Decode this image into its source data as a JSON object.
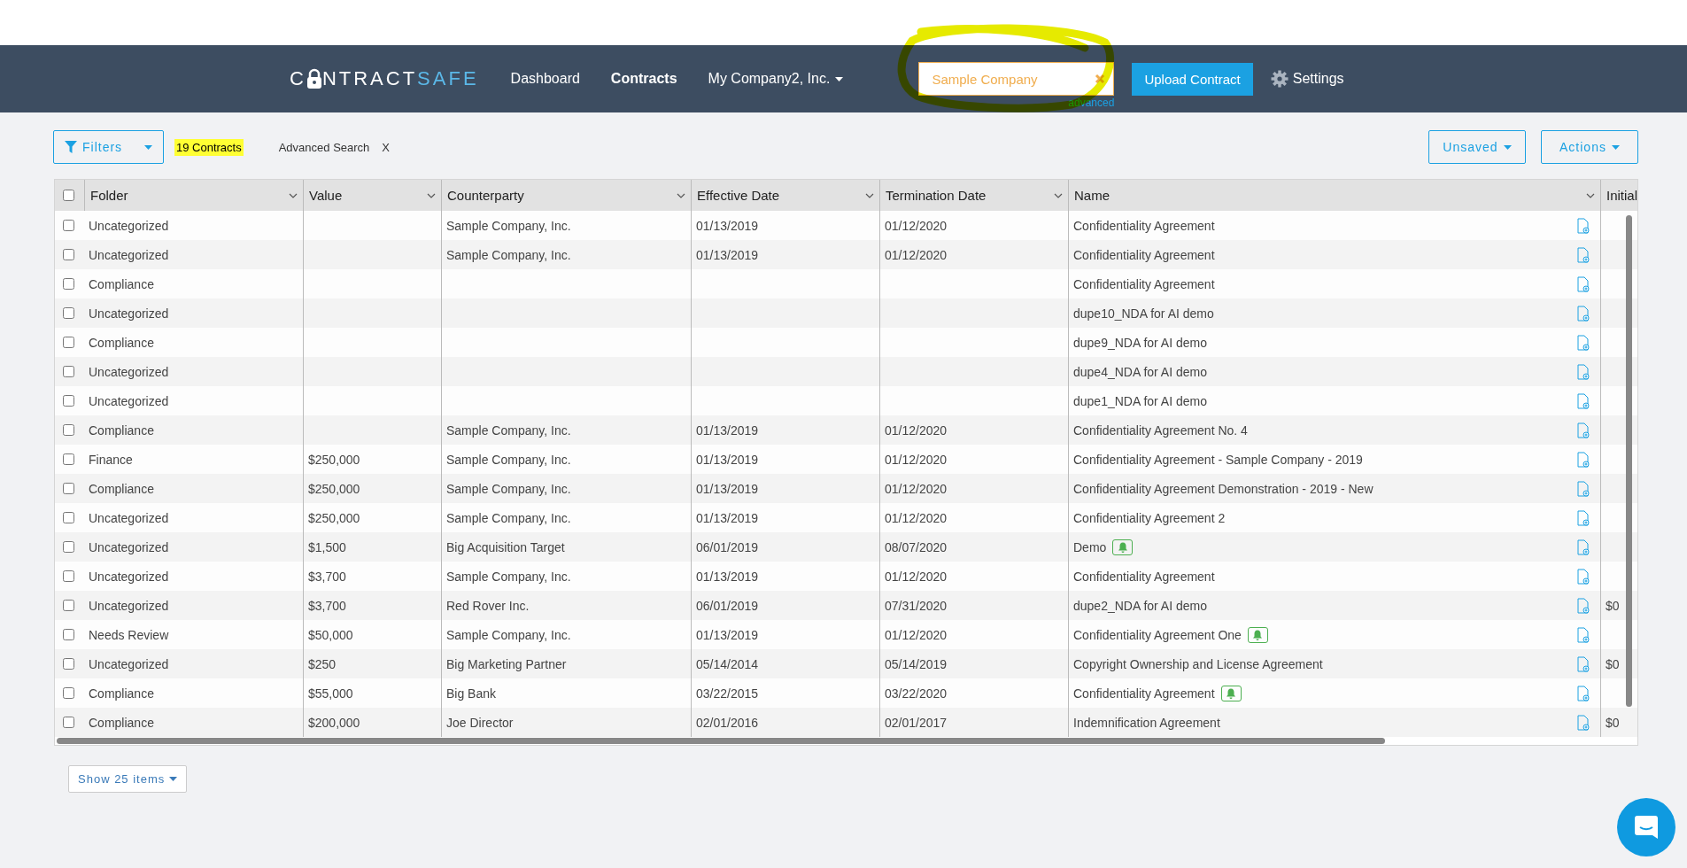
{
  "header": {
    "logo": [
      "C",
      "NTRACT",
      "SAFE"
    ],
    "nav": [
      {
        "label": "Dashboard",
        "kind": "link",
        "selected": false
      },
      {
        "label": "Contracts",
        "kind": "link",
        "selected": true
      },
      {
        "label": "My Company2, Inc.",
        "kind": "menu",
        "selected": false
      }
    ],
    "search": {
      "value": "Sample Company",
      "link": "advanced"
    },
    "upload_button": "Upload Contract",
    "settings": "Settings"
  },
  "toolbar": {
    "filters": "Filters",
    "count": "19 Contracts",
    "advanced_search": "Advanced Search",
    "clear": "X",
    "views": "Unsaved",
    "actions": "Actions"
  },
  "table": {
    "all_checked": false,
    "columns": [
      "Folder",
      "Value",
      "Counterparty",
      "Effective Date",
      "Termination Date",
      "Name",
      "Initial"
    ],
    "rows": [
      {
        "checked": false,
        "folder": "Uncategorized",
        "counterparty": "Sample Company, Inc.",
        "effective": "01/13/2019",
        "termination": "01/12/2020",
        "name": "Confidentiality Agreement",
        "alert": false
      },
      {
        "checked": false,
        "folder": "Uncategorized",
        "counterparty": "Sample Company, Inc.",
        "effective": "01/13/2019",
        "termination": "01/12/2020",
        "name": "Confidentiality Agreement",
        "alert": false
      },
      {
        "checked": false,
        "folder": "Compliance",
        "name": "Confidentiality Agreement",
        "alert": false
      },
      {
        "checked": false,
        "folder": "Uncategorized",
        "name": "dupe10_NDA for AI demo",
        "alert": false
      },
      {
        "checked": false,
        "folder": "Compliance",
        "name": "dupe9_NDA for AI demo",
        "alert": false
      },
      {
        "checked": false,
        "folder": "Uncategorized",
        "name": "dupe4_NDA for AI demo",
        "alert": false
      },
      {
        "checked": false,
        "folder": "Uncategorized",
        "name": "dupe1_NDA for AI demo",
        "alert": false
      },
      {
        "checked": false,
        "folder": "Compliance",
        "counterparty": "Sample Company, Inc.",
        "effective": "01/13/2019",
        "termination": "01/12/2020",
        "name": "Confidentiality Agreement No. 4",
        "alert": false
      },
      {
        "checked": false,
        "folder": "Finance",
        "value": "$250,000",
        "counterparty": "Sample Company, Inc.",
        "effective": "01/13/2019",
        "termination": "01/12/2020",
        "name": "Confidentiality Agreement - Sample Company - 2019",
        "alert": false
      },
      {
        "checked": false,
        "folder": "Compliance",
        "value": "$250,000",
        "counterparty": "Sample Company, Inc.",
        "effective": "01/13/2019",
        "termination": "01/12/2020",
        "name": "Confidentiality Agreement Demonstration - 2019 - New",
        "alert": false
      },
      {
        "checked": false,
        "folder": "Uncategorized",
        "value": "$250,000",
        "counterparty": "Sample Company, Inc.",
        "effective": "01/13/2019",
        "termination": "01/12/2020",
        "name": "Confidentiality Agreement 2",
        "alert": false
      },
      {
        "checked": false,
        "folder": "Uncategorized",
        "value": "$1,500",
        "counterparty": "Big Acquisition Target",
        "effective": "06/01/2019",
        "termination": "08/07/2020",
        "name": "Demo",
        "alert": true
      },
      {
        "checked": false,
        "folder": "Uncategorized",
        "value": "$3,700",
        "counterparty": "Sample Company, Inc.",
        "effective": "01/13/2019",
        "termination": "01/12/2020",
        "name": "Confidentiality Agreement",
        "alert": false
      },
      {
        "checked": false,
        "folder": "Uncategorized",
        "value": "$3,700",
        "counterparty": "Red Rover Inc.",
        "effective": "06/01/2019",
        "termination": "07/31/2020",
        "name": "dupe2_NDA for AI demo",
        "alert": false,
        "initial": "$0"
      },
      {
        "checked": false,
        "folder": "Needs Review",
        "value": "$50,000",
        "counterparty": "Sample Company, Inc.",
        "effective": "01/13/2019",
        "termination": "01/12/2020",
        "name": "Confidentiality Agreement One",
        "alert": true
      },
      {
        "checked": false,
        "folder": "Uncategorized",
        "value": "$250",
        "counterparty": "Big Marketing Partner",
        "effective": "05/14/2014",
        "termination": "05/14/2019",
        "name": "Copyright Ownership and License Agreement",
        "alert": false,
        "initial": "$0"
      },
      {
        "checked": false,
        "folder": "Compliance",
        "value": "$55,000",
        "counterparty": "Big Bank",
        "effective": "03/22/2015",
        "termination": "03/22/2020",
        "name": "Confidentiality Agreement",
        "alert": true
      },
      {
        "checked": false,
        "folder": "Compliance",
        "value": "$200,000",
        "counterparty": "Joe Director",
        "effective": "02/01/2016",
        "termination": "02/01/2017",
        "name": "Indemnification Agreement",
        "alert": false,
        "initial": "$0"
      }
    ]
  },
  "page_size": "Show 25 items"
}
